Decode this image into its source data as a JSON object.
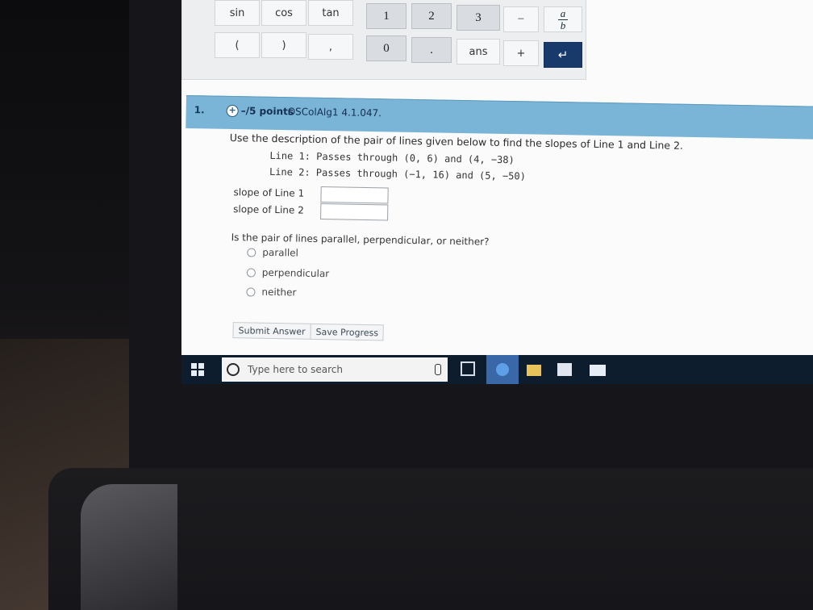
{
  "keypad": {
    "row1": [
      "sin",
      "cos",
      "tan",
      "1",
      "2",
      "3",
      "−"
    ],
    "row2": [
      "(",
      ")",
      ",",
      "0",
      ".",
      "ans",
      "+"
    ],
    "fraction": {
      "numerator": "a",
      "denominator": "b"
    },
    "enter_symbol": "↵"
  },
  "question": {
    "number": "1.",
    "points": "–/5 points",
    "id": "OSColAlg1 4.1.047.",
    "prompt": "Use the description of the pair of lines given below to find the slopes of Line 1 and Line 2.",
    "line1": "Line 1: Passes through (0, 6) and (4, −38)",
    "line2": "Line 2: Passes through (−1, 16) and (5, −50)",
    "slope1_label": "slope of Line 1",
    "slope2_label": "slope of Line 2",
    "mc_question": "Is the pair of lines parallel, perpendicular, or neither?",
    "options": [
      "parallel",
      "perpendicular",
      "neither"
    ],
    "submit_label": "Submit Answer",
    "save_label": "Save Progress"
  },
  "taskbar": {
    "search_placeholder": "Type here to search"
  }
}
